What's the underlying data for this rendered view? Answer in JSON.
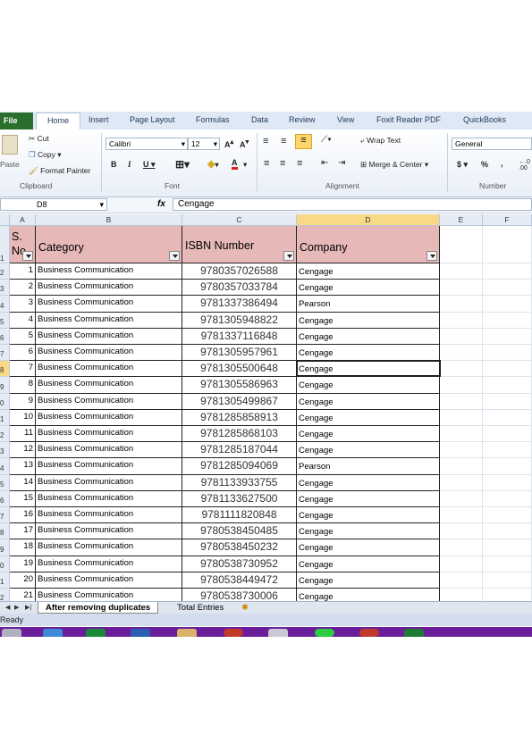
{
  "ribbon": {
    "tabs": [
      "File",
      "Home",
      "Insert",
      "Page Layout",
      "Formulas",
      "Data",
      "Review",
      "View",
      "Foxit Reader PDF",
      "QuickBooks"
    ],
    "active_tab": "Home",
    "clipboard": {
      "paste": "Paste",
      "cut": "Cut",
      "copy": "Copy",
      "format_painter": "Format Painter",
      "group_label": "Clipboard"
    },
    "font": {
      "name": "Calibri",
      "size": "12",
      "group_label": "Font"
    },
    "alignment": {
      "wrap_text": "Wrap Text",
      "merge_center": "Merge & Center",
      "group_label": "Alignment"
    },
    "number": {
      "format": "General",
      "currency": "$",
      "percent": "%",
      "comma": ",",
      "group_label": "Number"
    }
  },
  "formula_bar": {
    "name_box": "D8",
    "fx": "fx",
    "content": "Cengage"
  },
  "columns": [
    "A",
    "B",
    "C",
    "D",
    "E",
    "F"
  ],
  "selected_column": "D",
  "table": {
    "headers": {
      "sno": "S. No",
      "category": "Category",
      "isbn": "ISBN Number",
      "company": "Company"
    },
    "row_numbers_visible": [
      "1",
      "2",
      "3",
      "4",
      "5",
      "6",
      "7",
      "8",
      "9",
      "0",
      "1",
      "2",
      "3",
      "4",
      "5",
      "6",
      "7",
      "8",
      "9",
      "0",
      "1",
      "2"
    ],
    "selected_row_label": "8",
    "rows": [
      {
        "sno": "1",
        "category": "Business Communication",
        "isbn": "9780357026588",
        "company": "Cengage"
      },
      {
        "sno": "2",
        "category": "Business Communication",
        "isbn": "9780357033784",
        "company": "Cengage"
      },
      {
        "sno": "3",
        "category": "Business Communication",
        "isbn": "9781337386494",
        "company": "Pearson"
      },
      {
        "sno": "4",
        "category": "Business Communication",
        "isbn": "9781305948822",
        "company": "Cengage"
      },
      {
        "sno": "5",
        "category": "Business Communication",
        "isbn": "9781337116848",
        "company": "Cengage"
      },
      {
        "sno": "6",
        "category": "Business Communication",
        "isbn": "9781305957961",
        "company": "Cengage"
      },
      {
        "sno": "7",
        "category": "Business Communication",
        "isbn": "9781305500648",
        "company": "Cengage"
      },
      {
        "sno": "8",
        "category": "Business Communication",
        "isbn": "9781305586963",
        "company": "Cengage"
      },
      {
        "sno": "9",
        "category": "Business Communication",
        "isbn": "9781305499867",
        "company": "Cengage"
      },
      {
        "sno": "10",
        "category": "Business Communication",
        "isbn": "9781285858913",
        "company": "Cengage"
      },
      {
        "sno": "11",
        "category": "Business Communication",
        "isbn": "9781285868103",
        "company": "Cengage"
      },
      {
        "sno": "12",
        "category": "Business Communication",
        "isbn": "9781285187044",
        "company": "Cengage"
      },
      {
        "sno": "13",
        "category": "Business Communication",
        "isbn": "9781285094069",
        "company": "Pearson"
      },
      {
        "sno": "14",
        "category": "Business Communication",
        "isbn": "9781133933755",
        "company": "Cengage"
      },
      {
        "sno": "15",
        "category": "Business Communication",
        "isbn": "9781133627500",
        "company": "Cengage"
      },
      {
        "sno": "16",
        "category": "Business Communication",
        "isbn": "9781111820848",
        "company": "Cengage"
      },
      {
        "sno": "17",
        "category": "Business Communication",
        "isbn": "9780538450485",
        "company": "Cengage"
      },
      {
        "sno": "18",
        "category": "Business Communication",
        "isbn": "9780538450232",
        "company": "Cengage"
      },
      {
        "sno": "19",
        "category": "Business Communication",
        "isbn": "9780538730952",
        "company": "Cengage"
      },
      {
        "sno": "20",
        "category": "Business Communication",
        "isbn": "9780538449472",
        "company": "Cengage"
      },
      {
        "sno": "21",
        "category": "Business Communication",
        "isbn": "9780538730006",
        "company": "Cengage"
      }
    ]
  },
  "sheet_tabs": [
    "After removing duplicates",
    "Total Entries"
  ],
  "active_sheet": "After removing duplicates",
  "status": "Ready",
  "colors": {
    "header_fill": "#e6b9b8",
    "file_tab": "#2a6f2b",
    "taskbar": "#6a1e9a",
    "selected_header": "#f9d985"
  }
}
